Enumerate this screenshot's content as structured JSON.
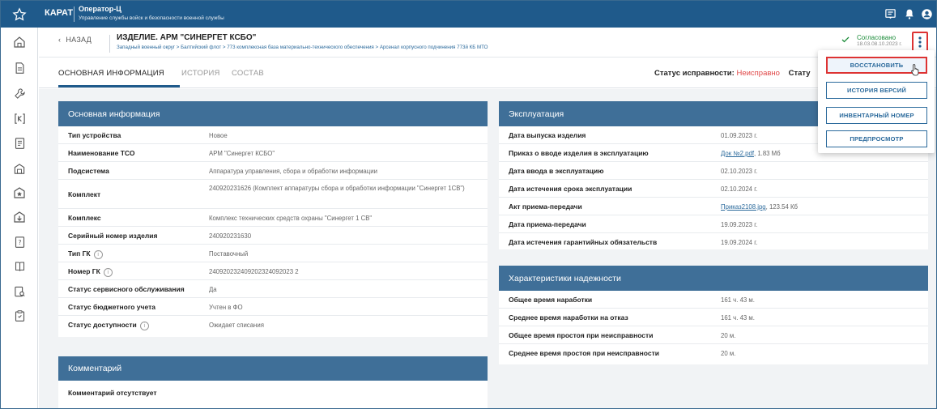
{
  "app": {
    "brand": "КАРАТ",
    "title": "Оператор-Ц",
    "subtitle": "Управление службы войск и безопасности военной службы"
  },
  "header": {
    "back_label": "НАЗАД",
    "item_title": "ИЗДЕЛИЕ. АРМ \"СИНЕРГЕТ КСБО\"",
    "breadcrumb": "Западный военный округ  >  Балтийский флот  >  773 комплексная база материально-технического обеспечения  >  Арсенал корпусного подчинения 773й КБ МТО",
    "status_label": "Согласовано",
    "status_date": "18.03.08.10.2023 г."
  },
  "tabs": [
    {
      "label": "ОСНОВНАЯ ИНФОРМАЦИЯ"
    },
    {
      "label": "ИСТОРИЯ"
    },
    {
      "label": "СОСТАВ"
    }
  ],
  "health": {
    "label": "Статус исправности:",
    "value": "Неисправно",
    "next_label": "Стату"
  },
  "basic": {
    "title": "Основная информация",
    "rows": [
      {
        "k": "Тип устройства",
        "v": "Новое"
      },
      {
        "k": "Наименование ТСО",
        "v": "АРМ \"Синергет КСБО\""
      },
      {
        "k": "Подсистема",
        "v": "Аппаратура управления, сбора и обработки информации"
      },
      {
        "k": "Комплект",
        "v": "240920231626 (Комплект аппаратуры сбора и обработки информации \"Синергет 1СВ\")"
      },
      {
        "k": "Комплекс",
        "v": "Комплекс технических средств охраны \"Синергет 1 СВ\""
      },
      {
        "k": "Серийный номер изделия",
        "v": "240920231630"
      },
      {
        "k": "Тип ГК",
        "v": "Поставочный"
      },
      {
        "k": "Номер ГК",
        "v": "240920232409202324092023 2"
      },
      {
        "k": "Статус сервисного обслуживания",
        "v": "Да"
      },
      {
        "k": "Статус бюджетного учета",
        "v": "Учтен в ФО"
      },
      {
        "k": "Статус доступности",
        "v": "Ожидает списания"
      }
    ]
  },
  "comment": {
    "title": "Комментарий",
    "text": "Комментарий отсутствует"
  },
  "operation": {
    "title": "Эксплуатация",
    "rows": [
      {
        "k": "Дата выпуска изделия",
        "v": "01.09.2023 г."
      },
      {
        "k": "Приказ о вводе изделия в эксплуатацию",
        "link": "Док №2.pdf",
        "size": ", 1.83 Мб"
      },
      {
        "k": "Дата ввода в эксплуатацию",
        "v": "02.10.2023 г."
      },
      {
        "k": "Дата истечения срока эксплуатации",
        "v": "02.10.2024 г."
      },
      {
        "k": "Акт приема-передачи",
        "link": "Приказ2108.jpg",
        "size": ", 123.54 Кб"
      },
      {
        "k": "Дата приема-передачи",
        "v": "19.09.2023 г."
      },
      {
        "k": "Дата истечения гарантийных обязательств",
        "v": "19.09.2024 г."
      }
    ]
  },
  "reliability": {
    "title": "Характеристики надежности",
    "rows": [
      {
        "k": "Общее время наработки",
        "v": "161 ч. 43 м."
      },
      {
        "k": "Среднее время наработки на отказ",
        "v": "161 ч. 43 м."
      },
      {
        "k": "Общее время простоя при неисправности",
        "v": "20 м."
      },
      {
        "k": "Среднее время простоя при неисправности",
        "v": "20 м."
      }
    ]
  },
  "menu": {
    "items": [
      {
        "label": "ВОССТАНОВИТЬ"
      },
      {
        "label": "ИСТОРИЯ ВЕРСИЙ"
      },
      {
        "label": "ИНВЕНТАРНЫЙ НОМЕР"
      },
      {
        "label": "ПРЕДПРОСМОТР"
      }
    ]
  },
  "colors": {
    "primary": "#1f5a8b",
    "card_header": "#3f6f98",
    "danger": "#e04848",
    "success": "#1c8c3a"
  }
}
